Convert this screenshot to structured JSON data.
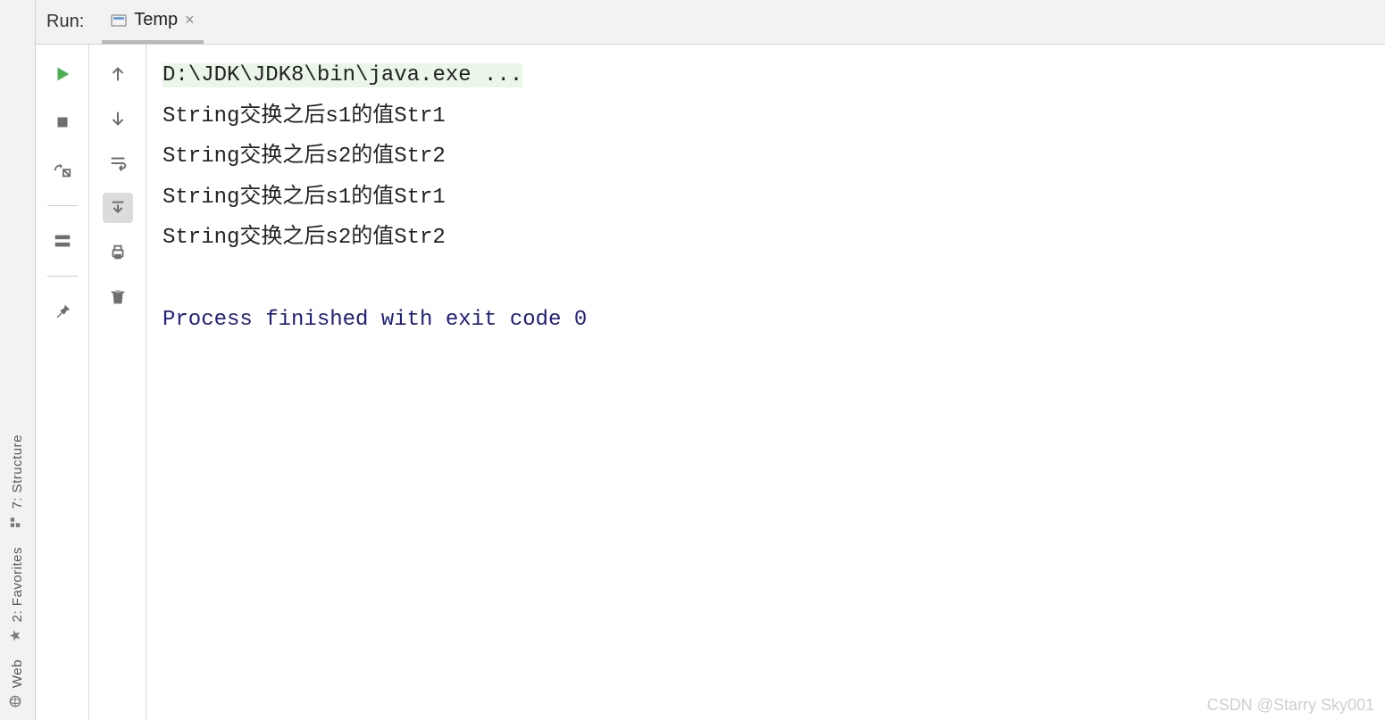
{
  "header": {
    "run_label": "Run:",
    "tab": {
      "title": "Temp",
      "close_glyph": "×"
    }
  },
  "left_rail": {
    "structure": {
      "label": "7: Structure",
      "icon": "structure"
    },
    "favorites": {
      "label": "2: Favorites",
      "icon": "star"
    },
    "web": {
      "label": "Web",
      "icon": "globe"
    }
  },
  "gutter1": {
    "run": "run-icon",
    "stop": "stop-icon",
    "debug": "debug-rerun-icon",
    "layout": "layout-icon",
    "pin": "pin-icon"
  },
  "gutter2": {
    "up": "arrow-up-icon",
    "down": "arrow-down-icon",
    "wrap": "soft-wrap-icon",
    "scroll": "scroll-to-end-icon",
    "print": "print-icon",
    "trash": "trash-icon"
  },
  "console": {
    "command": "D:\\JDK\\JDK8\\bin\\java.exe ...",
    "lines": [
      "String交换之后s1的值Str1",
      "String交换之后s2的值Str2",
      "String交换之后s1的值Str1",
      "String交换之后s2的值Str2"
    ],
    "exit_line": "Process finished with exit code 0"
  },
  "watermark": "CSDN @Starry Sky001"
}
